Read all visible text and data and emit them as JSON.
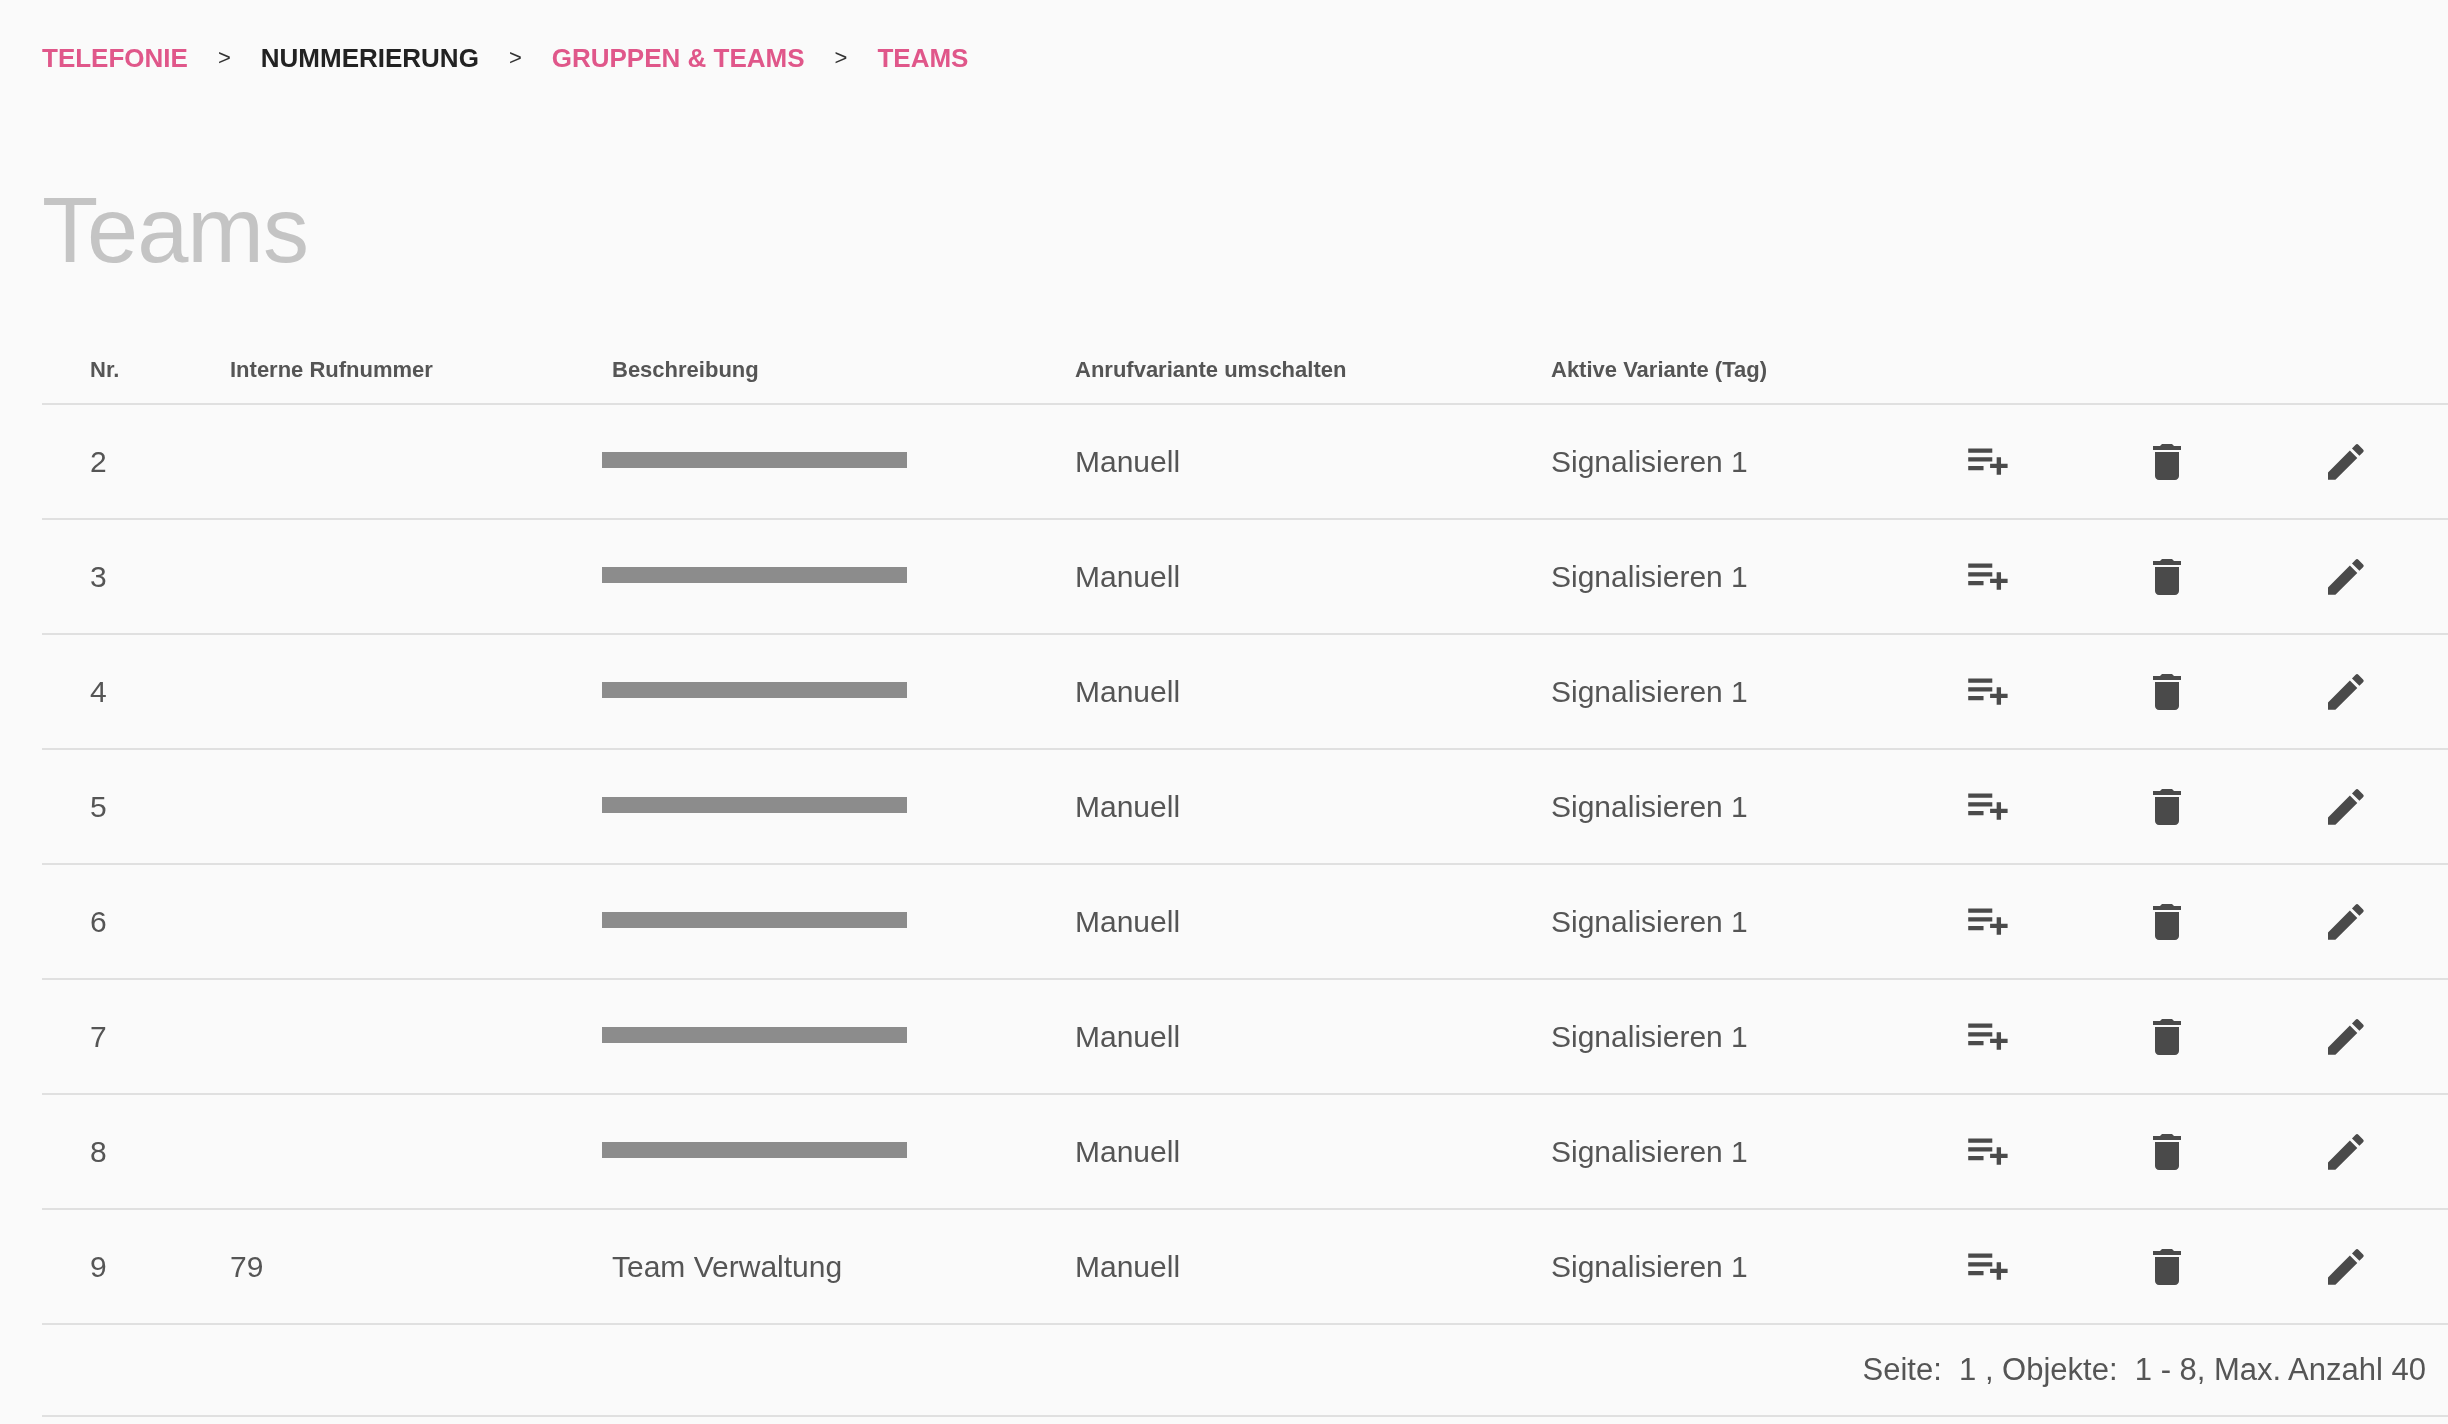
{
  "breadcrumb": [
    {
      "label": "TELEFONIE",
      "kind": "link"
    },
    {
      "label": ">",
      "kind": "separator"
    },
    {
      "label": "NUMMERIERUNG",
      "kind": "current"
    },
    {
      "label": ">",
      "kind": "separator"
    },
    {
      "label": "GRUPPEN & TEAMS",
      "kind": "link"
    },
    {
      "label": ">",
      "kind": "separator"
    },
    {
      "label": "TEAMS",
      "kind": "link"
    }
  ],
  "title": "Teams",
  "table": {
    "columns": [
      "Nr.",
      "Interne Rufnummer",
      "Beschreibung",
      "Anrufvariante umschalten",
      "Aktive Variante (Tag)"
    ],
    "rows": [
      {
        "nr": "2",
        "description": {
          "kind": "redacted"
        },
        "mode": "Manuell",
        "variant": "Signalisieren 1"
      },
      {
        "nr": "3",
        "description": {
          "kind": "redacted"
        },
        "mode": "Manuell",
        "variant": "Signalisieren 1"
      },
      {
        "nr": "4",
        "description": {
          "kind": "redacted"
        },
        "mode": "Manuell",
        "variant": "Signalisieren 1"
      },
      {
        "nr": "5",
        "description": {
          "kind": "redacted"
        },
        "mode": "Manuell",
        "variant": "Signalisieren 1"
      },
      {
        "nr": "6",
        "description": {
          "kind": "redacted"
        },
        "mode": "Manuell",
        "variant": "Signalisieren 1"
      },
      {
        "nr": "7",
        "description": {
          "kind": "redacted"
        },
        "mode": "Manuell",
        "variant": "Signalisieren 1"
      },
      {
        "nr": "8",
        "description": {
          "kind": "redacted"
        },
        "mode": "Manuell",
        "variant": "Signalisieren 1"
      },
      {
        "nr": "9",
        "number": "79",
        "description": {
          "kind": "text",
          "text": "Team Verwaltung"
        },
        "mode": "Manuell",
        "variant": "Signalisieren 1"
      }
    ]
  },
  "pagination": "Seite:  1 , Objekte:  1 - 8, Max. Anzahl 40"
}
